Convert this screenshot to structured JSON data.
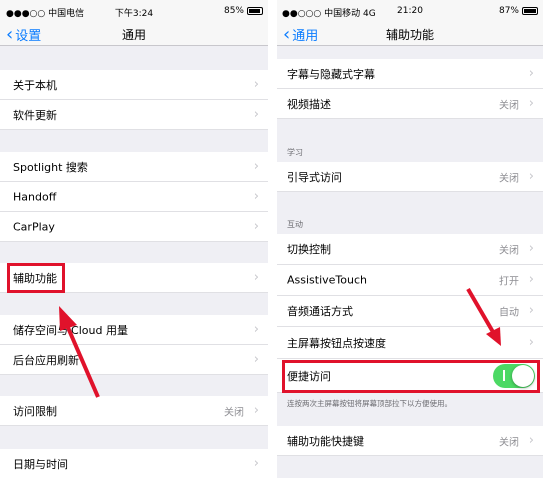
{
  "colors": {
    "accent": "#0a7cff",
    "highlight": "#e0122b",
    "toggle_on": "#4cd964"
  },
  "left": {
    "status": {
      "carrier": "●●●○○ 中国电信",
      "time": "下午3:24",
      "battery": "85%"
    },
    "nav": {
      "back_label": "设置",
      "title": "通用"
    },
    "rows": {
      "about": "关于本机",
      "software_update": "软件更新",
      "spotlight": "Spotlight 搜索",
      "handoff": "Handoff",
      "carplay": "CarPlay",
      "accessibility": "辅助功能",
      "storage": "储存空间与iCloud 用量",
      "background_refresh": "后台应用刷新",
      "restrictions": {
        "label": "访问限制",
        "value": "关闭"
      },
      "date_time": "日期与时间"
    }
  },
  "right": {
    "status": {
      "carrier": "●●○○○ 中国移动  4G",
      "time": "21:20",
      "battery": "87%"
    },
    "nav": {
      "back_label": "通用",
      "title": "辅助功能"
    },
    "rows": {
      "subtitles": "字幕与隐藏式字幕",
      "audio_desc": {
        "label": "视频描述",
        "value": "关闭"
      },
      "guided_access": {
        "label": "引导式访问",
        "value": "关闭"
      },
      "switch_control": {
        "label": "切换控制",
        "value": "关闭"
      },
      "assistive_touch": {
        "label": "AssistiveTouch",
        "value": "打开"
      },
      "call_audio": {
        "label": "音频通话方式",
        "value": "自动"
      },
      "home_speed": "主屏幕按钮点按速度",
      "reachability": {
        "label": "便捷访问",
        "on": true
      },
      "shortcut": {
        "label": "辅助功能快捷键",
        "value": "关闭"
      }
    },
    "sections": {
      "learning": "学习",
      "interaction": "互动"
    },
    "reachability_note": "连按两次主屏幕按钮将屏幕顶部拉下以方便使用。"
  }
}
